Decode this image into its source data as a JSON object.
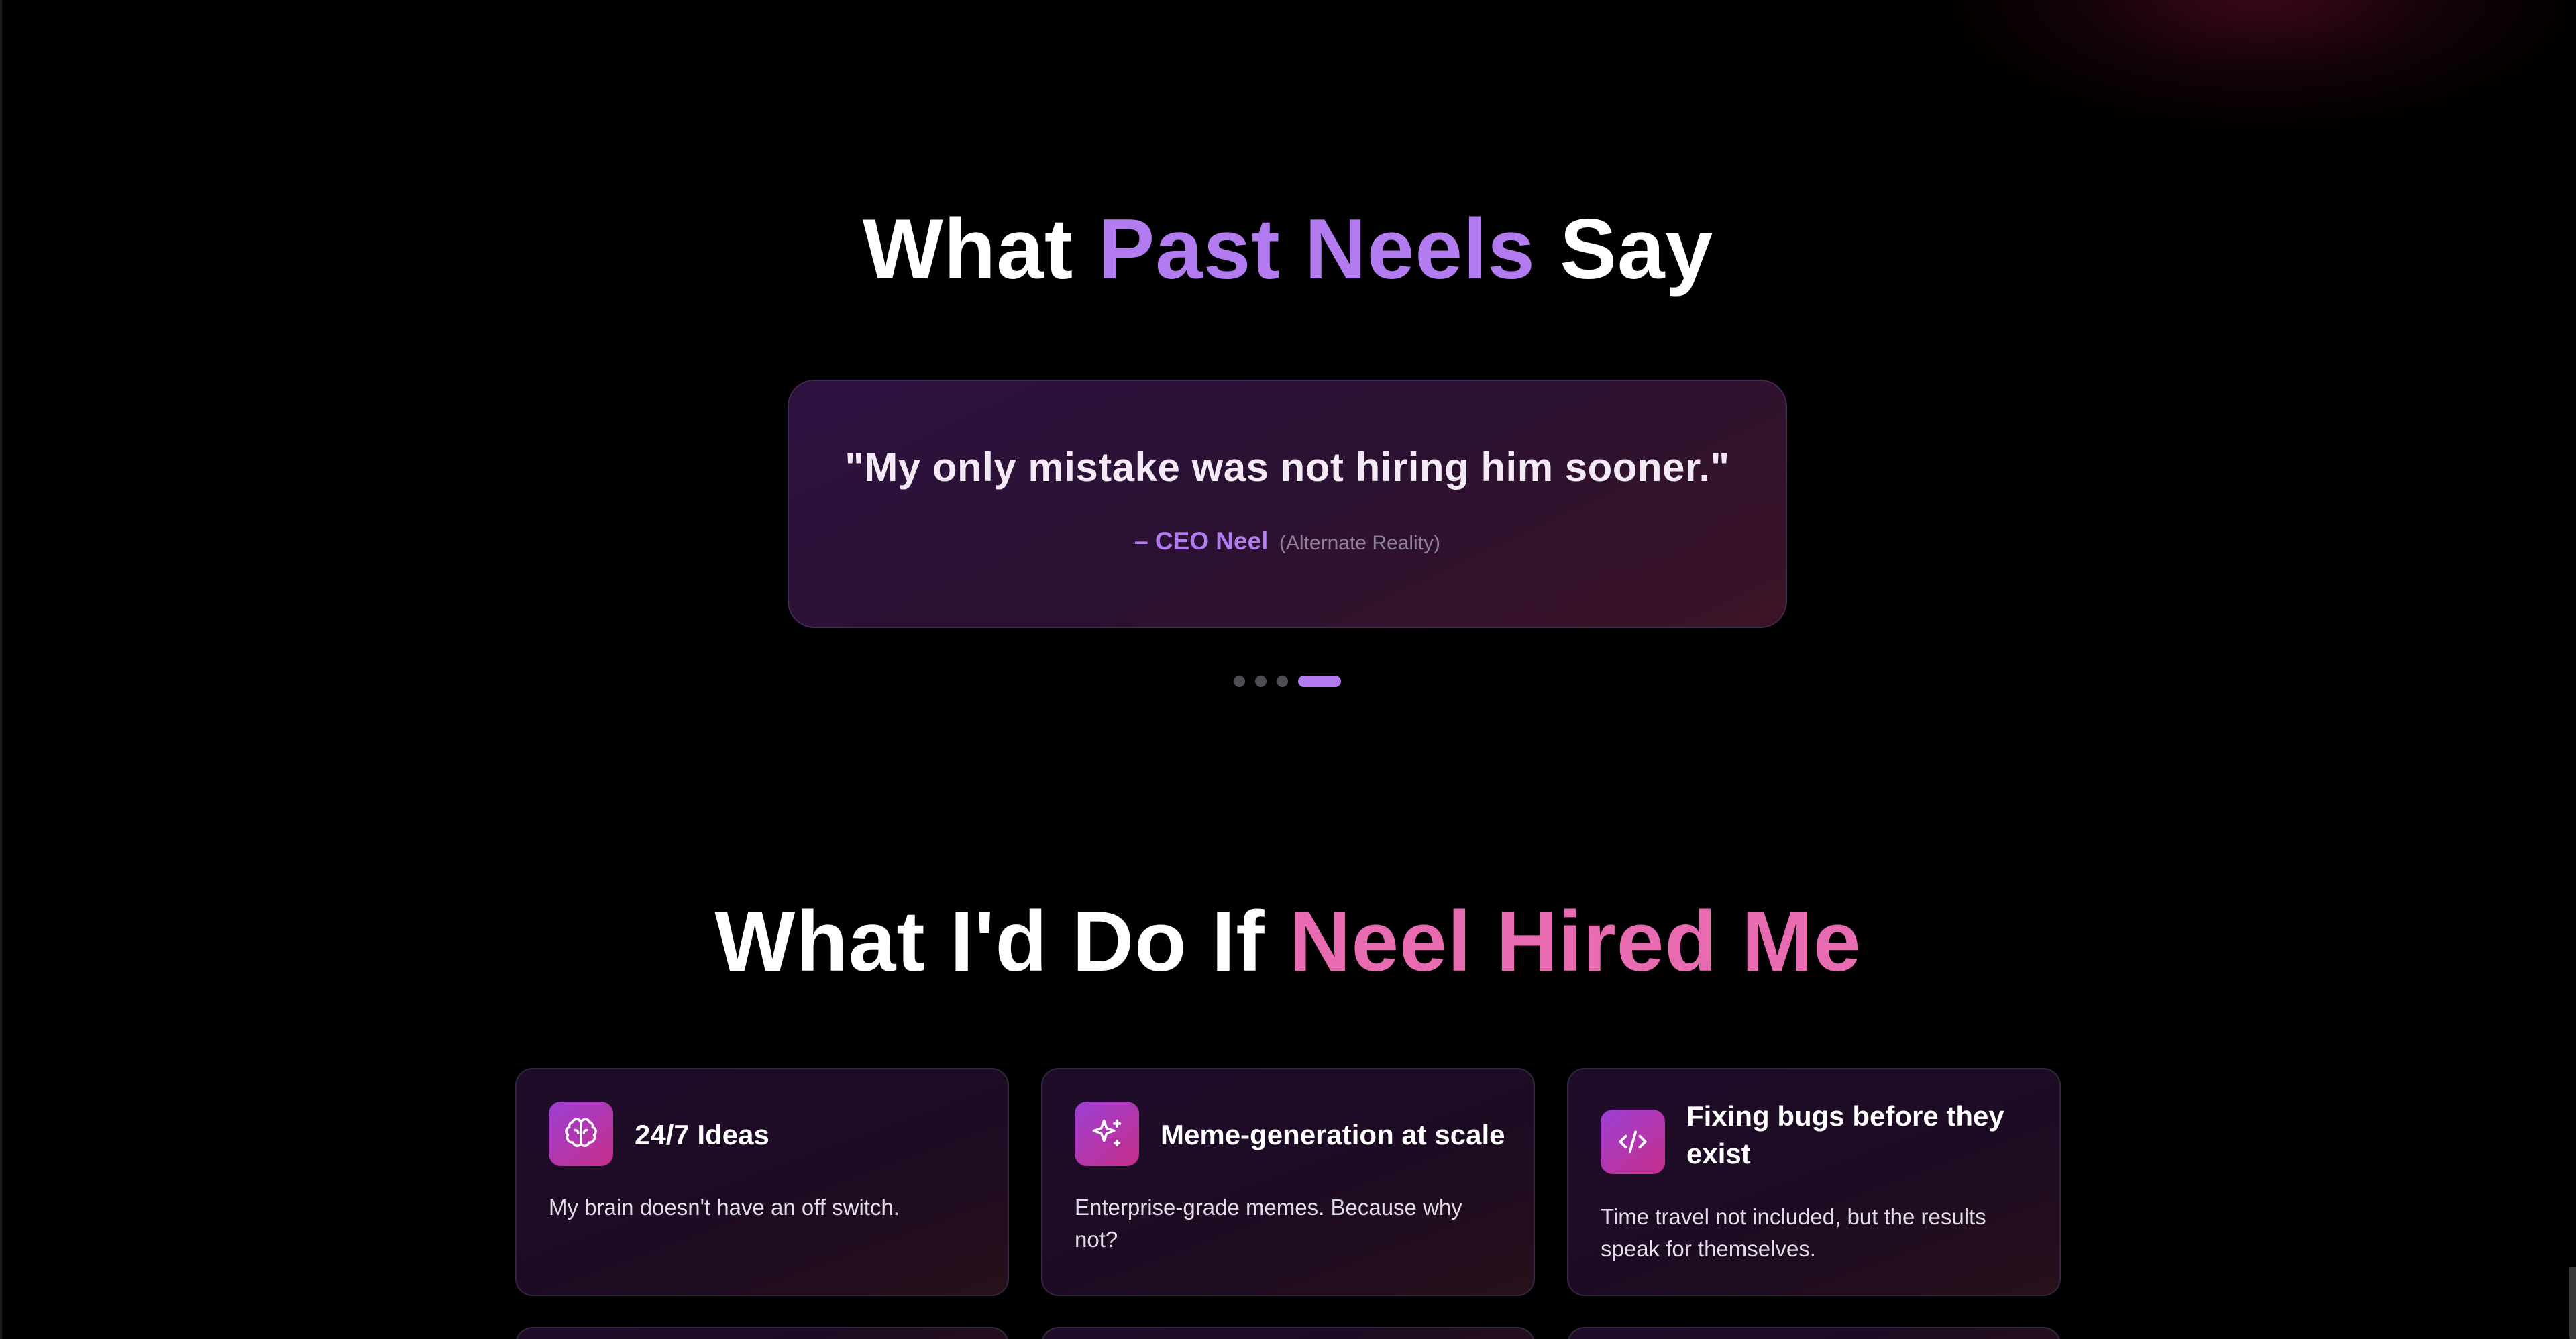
{
  "testimonials_section": {
    "title_pre": "What ",
    "title_accent": "Past Neels",
    "title_post": " Say",
    "quote": "\"My only mistake was not hiring him sooner.\"",
    "author": "– CEO Neel",
    "author_note": "(Alternate Reality)",
    "carousel": {
      "slide_count": 4,
      "active_index": 3
    }
  },
  "hired_section": {
    "title_pre": "What I'd Do If ",
    "title_accent": "Neel Hired Me",
    "cards": [
      {
        "icon": "brain-icon",
        "title": "24/7 Ideas",
        "text": "My brain doesn't have an off switch."
      },
      {
        "icon": "sparkles-icon",
        "title": "Meme-generation at scale",
        "text": "Enterprise-grade memes. Because why not?"
      },
      {
        "icon": "code-icon",
        "title": "Fixing bugs before they exist",
        "text": "Time travel not included, but the results speak for themselves."
      }
    ]
  },
  "colors": {
    "background": "#000000",
    "accent_purple": "#b27cf0",
    "accent_pink": "#e86bb2",
    "icon_gradient_start": "#9b3fd4",
    "icon_gradient_end": "#c72f8a"
  }
}
